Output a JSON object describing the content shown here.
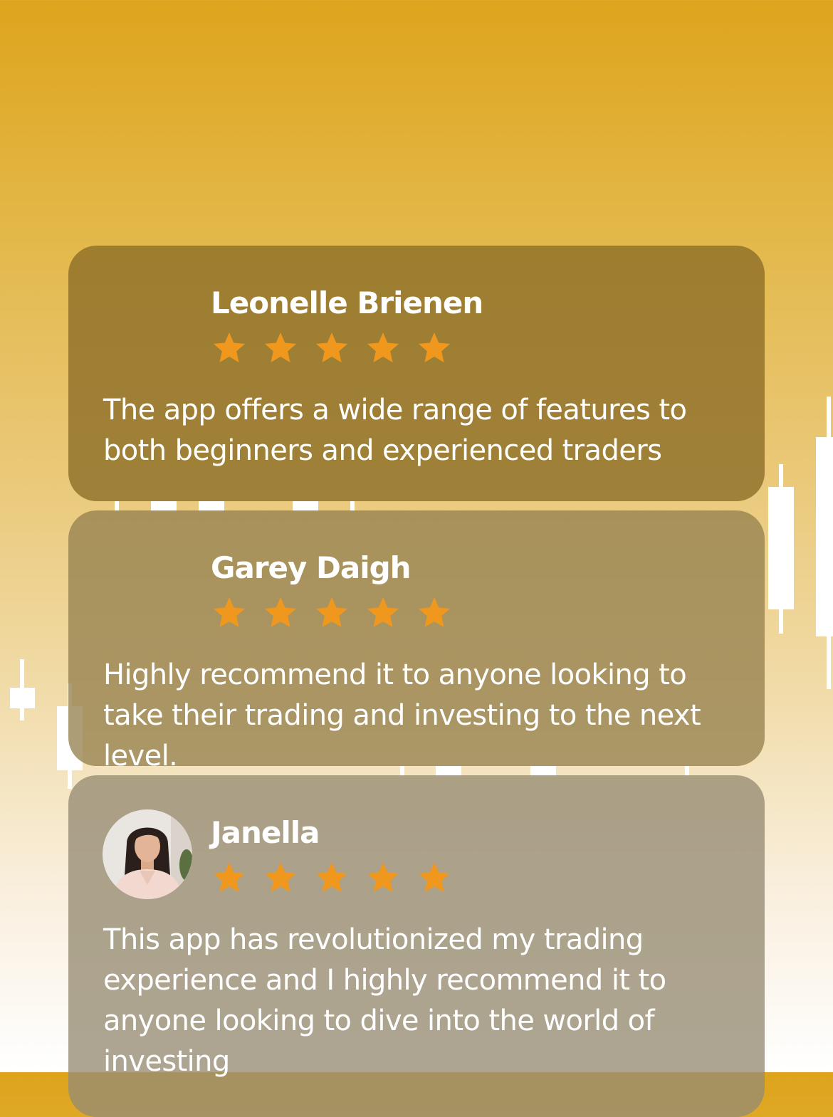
{
  "reviews": [
    {
      "name": "Leonelle Brienen",
      "rating": 5,
      "rating_max": 5,
      "has_avatar": false,
      "text": "The app offers a wide range of features to both beginners and experienced traders"
    },
    {
      "name": "Garey Daigh",
      "rating": 5,
      "rating_max": 5,
      "has_avatar": false,
      "text": "Highly recommend it to anyone looking to take their trading and investing to the next level."
    },
    {
      "name": "Janella",
      "rating": 5,
      "rating_max": 5,
      "has_avatar": true,
      "avatar_icon": "user-photo",
      "text": "This app has revolutionized my trading experience and I highly recommend it to anyone looking to dive into the world of investing"
    }
  ],
  "colors": {
    "background_top": "#dea41c",
    "background_bottom": "#ffffff",
    "star": "#f0981e",
    "text": "#ffffff",
    "candlestick": "#ffffff"
  },
  "icons": {
    "star": "star-icon",
    "background": "candlestick-chart-icon"
  }
}
